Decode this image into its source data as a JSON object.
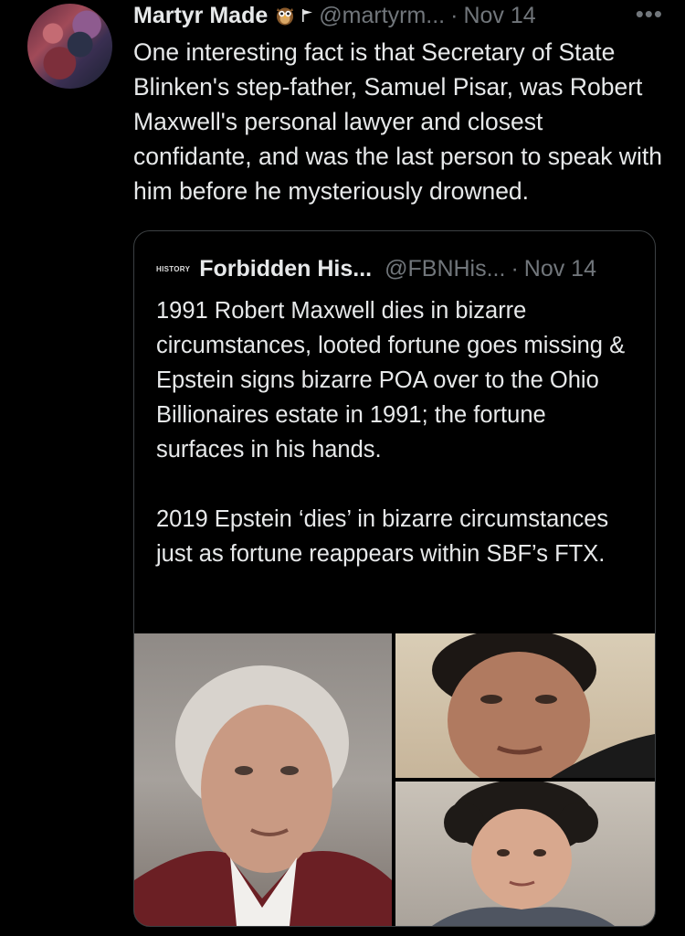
{
  "tweet": {
    "author_name": "Martyr Made",
    "author_handle": "@martyrm...",
    "separator": "·",
    "date": "Nov 14",
    "more_label": "•••",
    "text": "One interesting fact is that Secretary of State Blinken's step-father, Samuel Pisar, was Robert Maxwell's personal lawyer and closest confidante, and was the last person to speak with him before he mysteriously drowned."
  },
  "quoted_tweet": {
    "logo_text": "HISTORY",
    "author_name": "Forbidden His...",
    "author_handle": "@FBNHis...",
    "separator": "·",
    "date": "Nov 14",
    "paragraph_1": "1991 Robert Maxwell dies in bizarre circumstances, looted fortune goes missing & Epstein signs bizarre POA over to the Ohio Billionaires estate in 1991; the fortune surfaces in his hands.",
    "paragraph_2": "2019 Epstein ‘dies’ in bizarre circumstances just as fortune reappears within SBF’s FTX."
  },
  "colors": {
    "background": "#000000",
    "text": "#e7e9ea",
    "muted": "#71767b",
    "border": "#3c4043"
  },
  "icons": [
    "owl-emoji-icon",
    "flag-icon",
    "more-options-icon",
    "history-logo-icon"
  ]
}
